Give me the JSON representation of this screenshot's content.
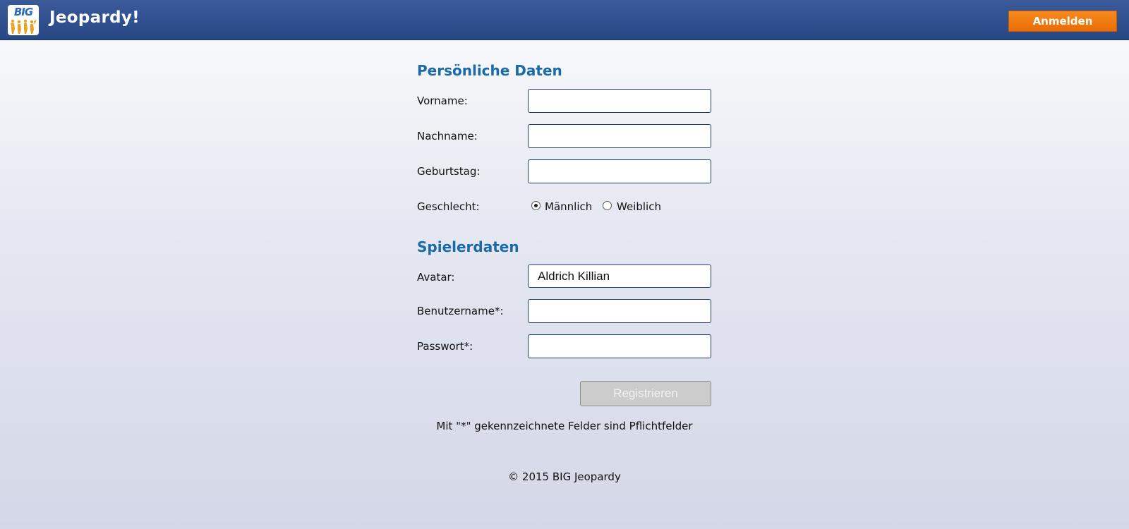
{
  "header": {
    "logo_text": "BIG",
    "title": "Jeopardy!",
    "login_label": "Anmelden"
  },
  "personal": {
    "section_title": "Persönliche Daten",
    "firstname_label": "Vorname:",
    "firstname_value": "",
    "lastname_label": "Nachname:",
    "lastname_value": "",
    "birthday_label": "Geburtstag:",
    "birthday_value": "",
    "gender_label": "Geschlecht:",
    "gender_options": [
      "Männlich",
      "Weiblich"
    ],
    "gender_selected": "Männlich"
  },
  "player": {
    "section_title": "Spielerdaten",
    "avatar_label": "Avatar:",
    "avatar_value": "Aldrich Killian",
    "username_label": "Benutzername*:",
    "username_value": "",
    "password_label": "Passwort*:",
    "password_value": ""
  },
  "form": {
    "register_label": "Registrieren",
    "required_hint": "Mit \"*\" gekennzeichnete Felder sind Pflichtfelder"
  },
  "footer": {
    "copyright": "© 2015 BIG Jeopardy"
  },
  "colors": {
    "header_bg": "#2f4f8f",
    "accent_orange": "#f07d0f",
    "section_title": "#1a6aa8"
  }
}
